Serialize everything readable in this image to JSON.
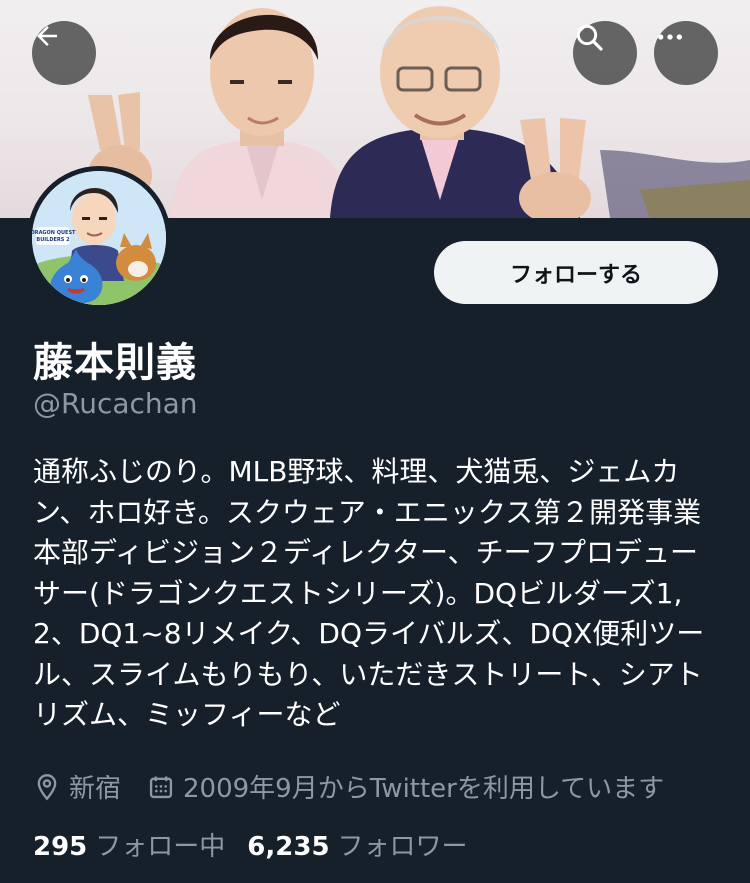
{
  "profile": {
    "display_name": "藤本則義",
    "handle": "@Rucachan",
    "bio": "通称ふじのり。MLB野球、料理、犬猫兎、ジェムカン、ホロ好き。スクウェア・エニックス第２開発事業本部ディビジョン２ディレクター、チーフプロデューサー(ドラゴンクエストシリーズ)。DQビルダーズ1,2、DQ1~8リメイク、DQライバルズ、DQX便利ツール、スライムもりもり、いただきストリート、シアトリズム、ミッフィーなど",
    "location": "新宿",
    "joined": "2009年9月からTwitterを利用しています",
    "following_count": "295",
    "following_label": "フォロー中",
    "followers_count": "6,235",
    "followers_label": "フォロワー",
    "avatar_text": "DRAGON QUEST BUILDERS 2"
  },
  "actions": {
    "follow_label": "フォローする"
  },
  "icons": {
    "back": "back-arrow-icon",
    "search": "search-icon",
    "more": "more-icon",
    "location": "location-pin-icon",
    "calendar": "calendar-icon"
  },
  "colors": {
    "background": "#15202b",
    "secondary_text": "#8b98a5",
    "follow_button_bg": "#eff3f4"
  }
}
